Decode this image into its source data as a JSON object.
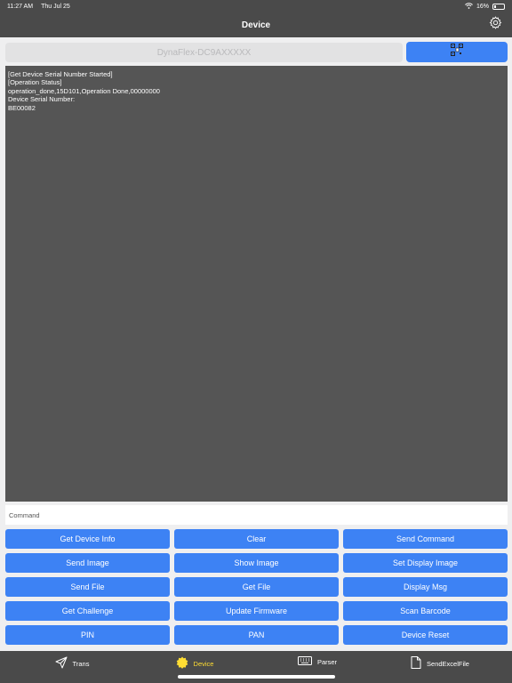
{
  "status_bar": {
    "time": "11:27 AM",
    "date": "Thu Jul 25",
    "battery": "16%"
  },
  "nav": {
    "title": "Device"
  },
  "device_field": {
    "value": "DynaFlex-DC9AXXXXX"
  },
  "log": {
    "text": "[Get Device Serial Number Started]\n[Operation Status]\noperation_done,15D101,Operation Done,00000000\nDevice Serial Number:\nBE00082"
  },
  "command": {
    "placeholder": "Command"
  },
  "buttons": [
    "Get Device Info",
    "Clear",
    "Send Command",
    "Send Image",
    "Show Image",
    "Set Display Image",
    "Send File",
    "Get File",
    "Display Msg",
    "Get Challenge",
    "Update Firmware",
    "Scan Barcode",
    "PIN",
    "PAN",
    "Device Reset"
  ],
  "tabs": [
    {
      "label": "Trans",
      "icon": "send-icon"
    },
    {
      "label": "Device",
      "icon": "device-badge-icon",
      "active": true
    },
    {
      "label": "Parser",
      "icon": "keyboard-icon"
    },
    {
      "label": "SendExcelFile",
      "icon": "document-icon"
    }
  ],
  "colors": {
    "accent": "#3d82f4",
    "bar": "#4a4a4a",
    "log_bg": "#555555",
    "active_tab": "#ffdd33"
  }
}
